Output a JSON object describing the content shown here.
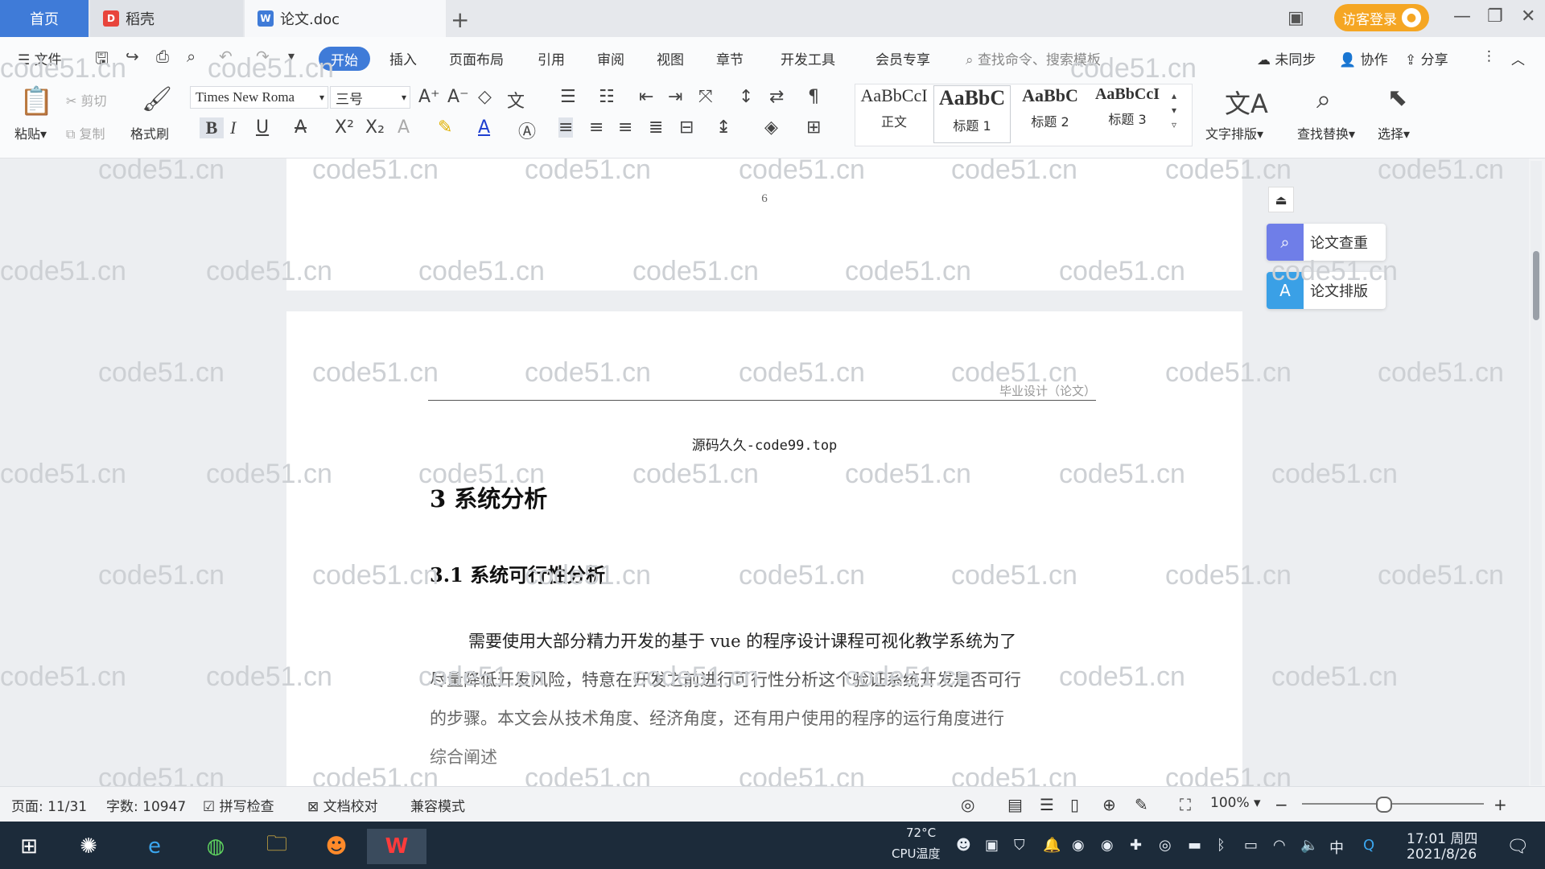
{
  "tabs": {
    "home": "首页",
    "daoke": "稻壳",
    "doc": "论文.doc"
  },
  "titlebar": {
    "guest_login": "访客登录"
  },
  "menu": {
    "file": "文件",
    "start": "开始",
    "insert": "插入",
    "layout": "页面布局",
    "reference": "引用",
    "review": "审阅",
    "view": "视图",
    "chapter": "章节",
    "devtools": "开发工具",
    "member": "会员专享",
    "search_placeholder": "查找命令、搜索模板",
    "unsynced": "未同步",
    "collab": "协作",
    "share": "分享"
  },
  "toolbar": {
    "paste": "粘贴",
    "cut": "剪切",
    "copy": "复制",
    "format_painter": "格式刷",
    "font_name": "Times New Roma",
    "font_size": "三号",
    "styles": [
      {
        "sample": "AaBbCcI",
        "label": "正文"
      },
      {
        "sample": "AaBbC",
        "label": "标题 1"
      },
      {
        "sample": "AaBbC",
        "label": "标题 2"
      },
      {
        "sample": "AaBbCcI",
        "label": "标题 3"
      }
    ],
    "text_layout": "文字排版",
    "find_replace": "查找替换",
    "select": "选择"
  },
  "side_panel": {
    "check": "论文查重",
    "format": "论文排版"
  },
  "document": {
    "page_number": "6",
    "header_text": "毕业设计（论文）",
    "source_line": "源码久久-code99.top",
    "chapter_title": "3  系统分析",
    "section_title": "3.1 系统可行性分析",
    "para_lines": [
      "需要使用大部分精力开发的基于 vue 的程序设计课程可视化教学系统为了",
      "尽量降低开发风险，特意在开发之前进行可行性分析这个验证系统开发是否可行",
      "的步骤。本文会从技术角度、经济角度，还有用户使用的程序的运行角度进行",
      "综合阐述"
    ]
  },
  "watermark": "code51.cn",
  "statusbar": {
    "page": "页面: 11/31",
    "words": "字数: 10947",
    "spell": "拼写检查",
    "proof": "文档校对",
    "compat": "兼容模式",
    "zoom": "100%"
  },
  "taskbar": {
    "cpu_temp": "72°C",
    "cpu_label": "CPU温度",
    "ime": "中",
    "time": "17:01 周四",
    "date": "2021/8/26"
  },
  "colors": {
    "accent": "#3f7bd8",
    "guest": "#f5a623",
    "taskbar": "#1c2b3a"
  }
}
